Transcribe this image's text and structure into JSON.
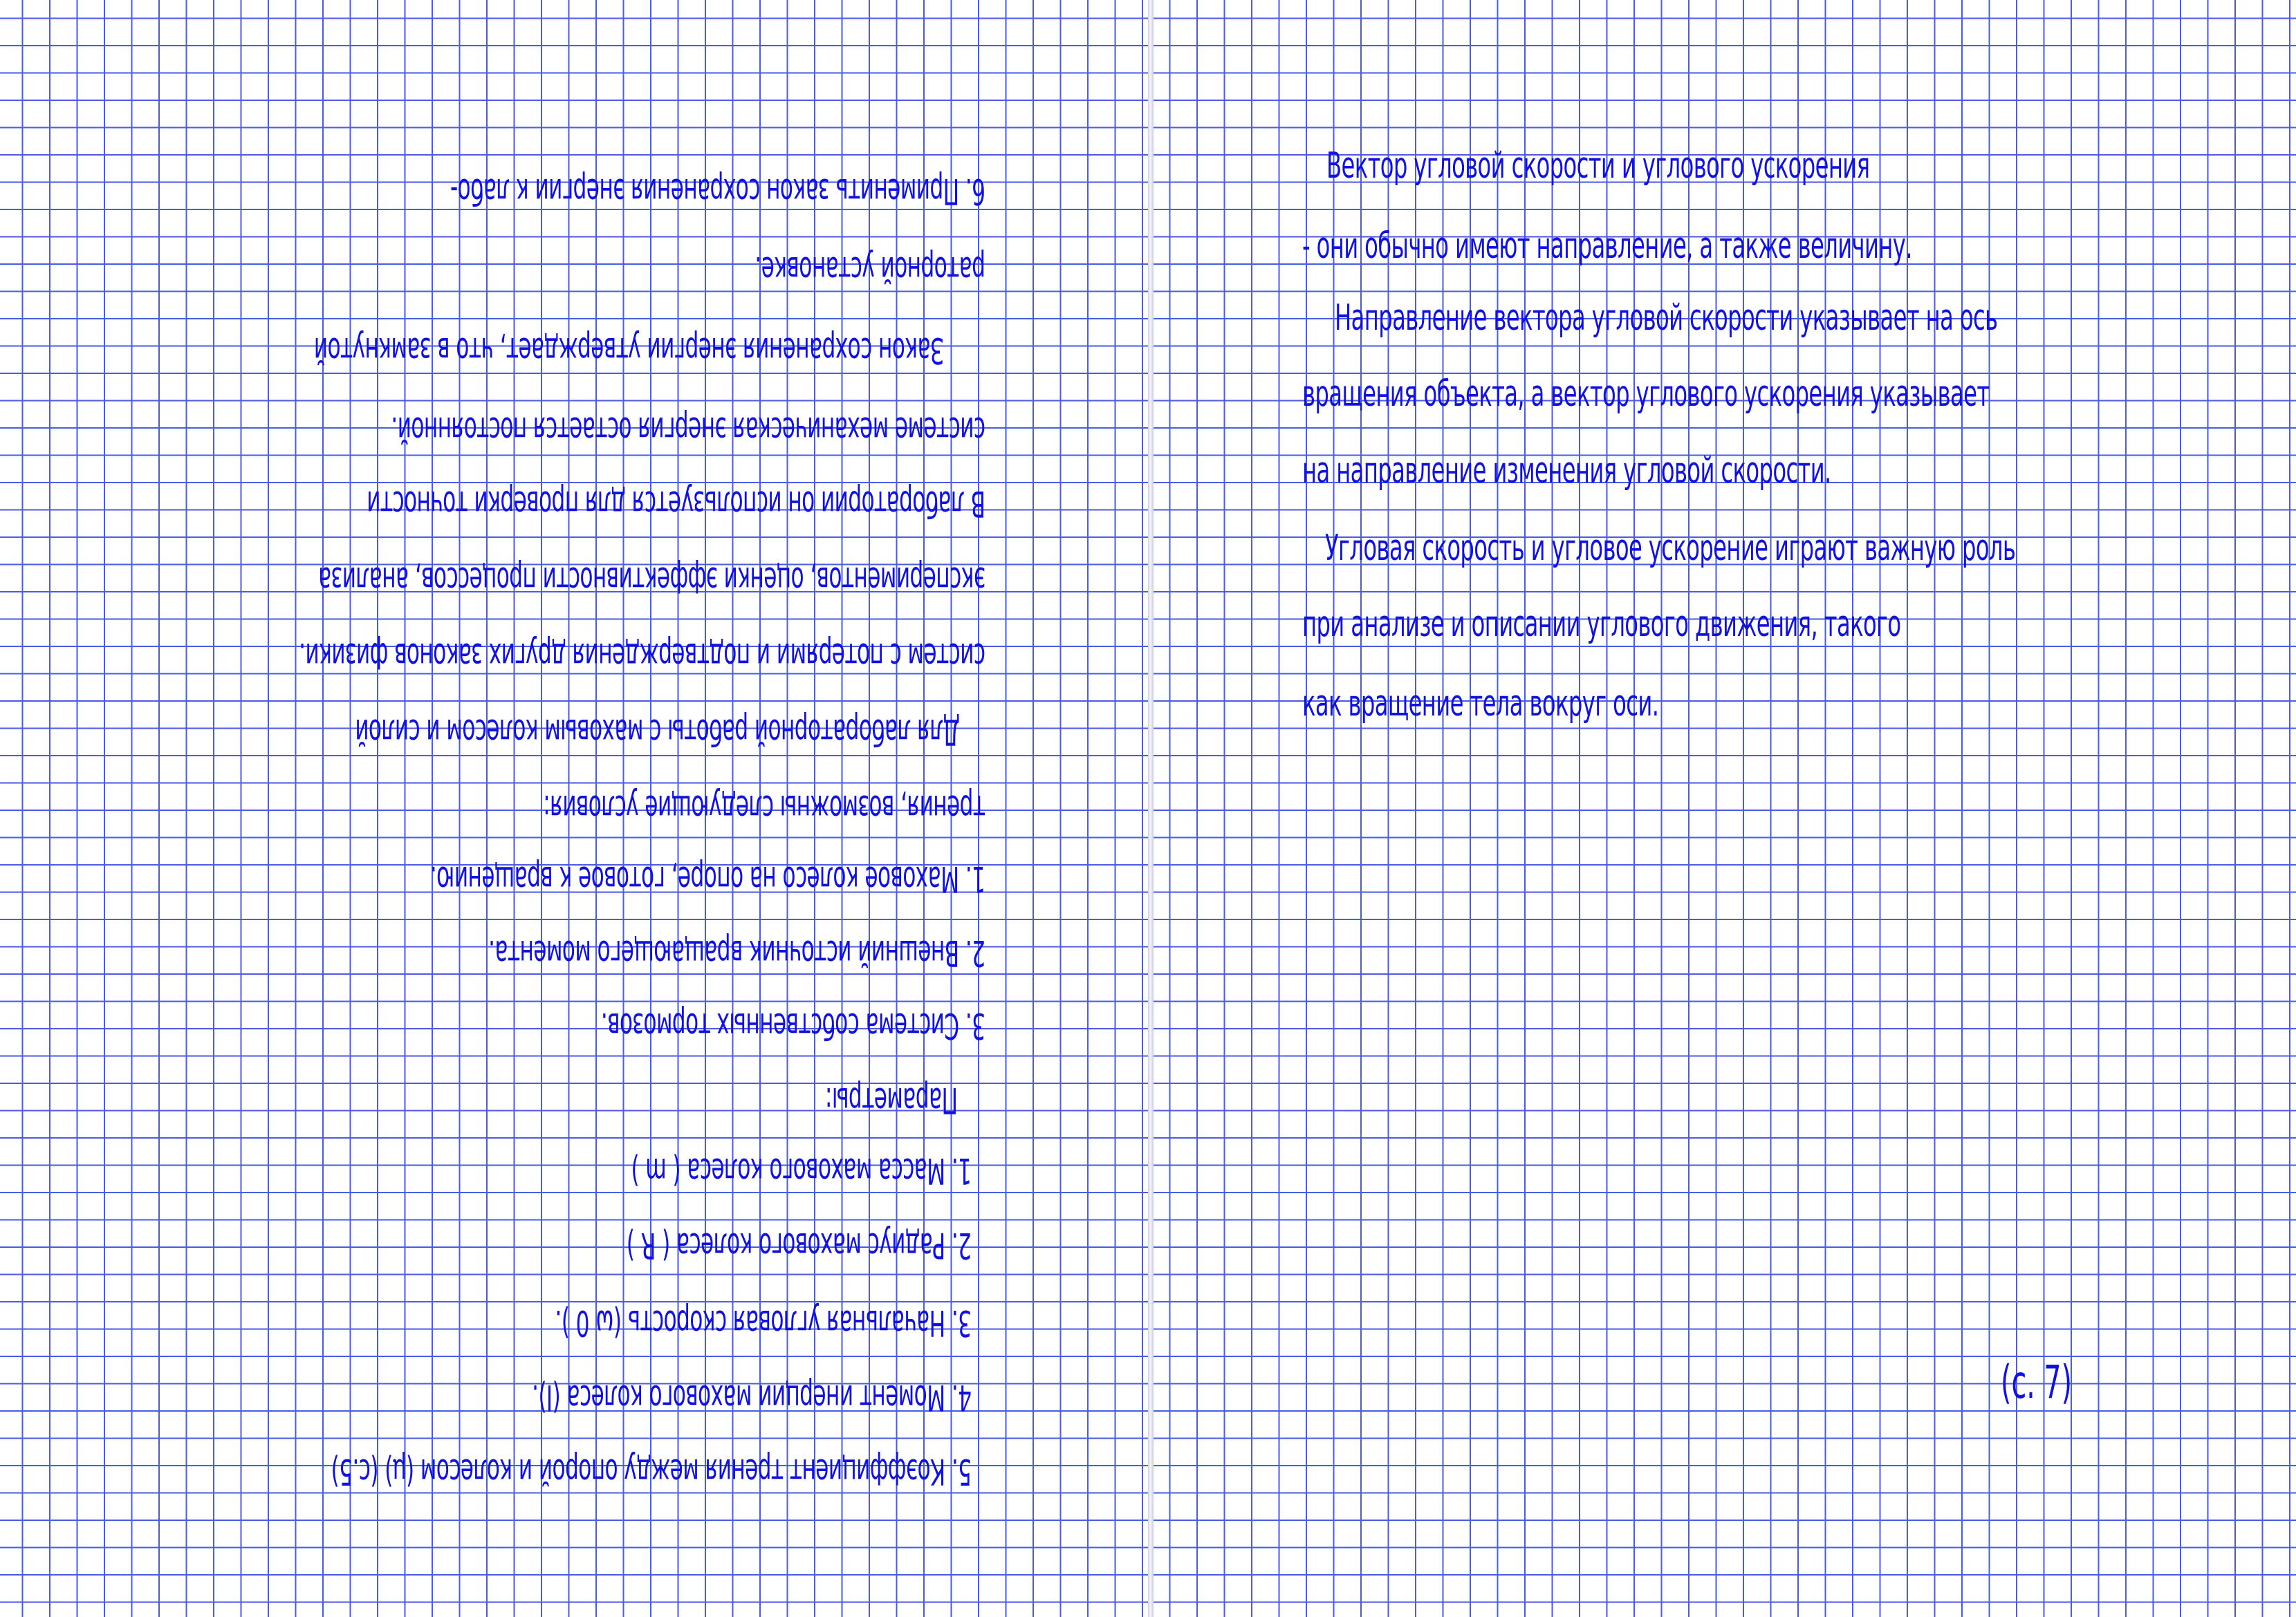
{
  "left_page": {
    "lines": [
      "6. Применить закон сохранения энергии к лабо-",
      "раторной установке.",
      "Закон сохранения энергии утверждает, что в замкнутой",
      "системе механическая энергия остается постоянной.",
      "В лаборатории он используется для проверки точности",
      "экспериментов, оценки эффективности процессов, анализа",
      "систем с потерями и подтверждения других законов физики.",
      "Для лабораторной работы с маховым колесом и силой",
      "трения, возможны следующие условия:",
      "1. Маховое колесо на опоре, готовое к вращению.",
      "2. Внешний источник вращающего момента.",
      "3. Система собственных тормозов.",
      "Параметры:",
      "1. Масса махового колеса ( m )",
      "2. Радиус махового колеса ( R )",
      "3. Начальная угловая скорость (ω 0 ).",
      "4. Момент инерции махового колеса (I).",
      "5. Коэффициент трения между опорой и колесом (μ)  (с.5)"
    ]
  },
  "right_page": {
    "lines": [
      "Вектор угловой скорости и углового ускорения",
      "- они обычно имеют направление, а также величину.",
      "Направление вектора угловой скорости указывает на ось",
      "вращения объекта, а вектор углового ускорения указывает",
      "на направление изменения угловой скорости.",
      "Угловая скорость и угловое ускорение играют важную роль",
      "при анализе и описании углового движения, такого",
      "как вращение тела вокруг оси."
    ],
    "page_number": "(с. 7)"
  },
  "colors": {
    "ink": "#1212e0",
    "grid": "#4a5be6",
    "paper": "#ffffff"
  }
}
